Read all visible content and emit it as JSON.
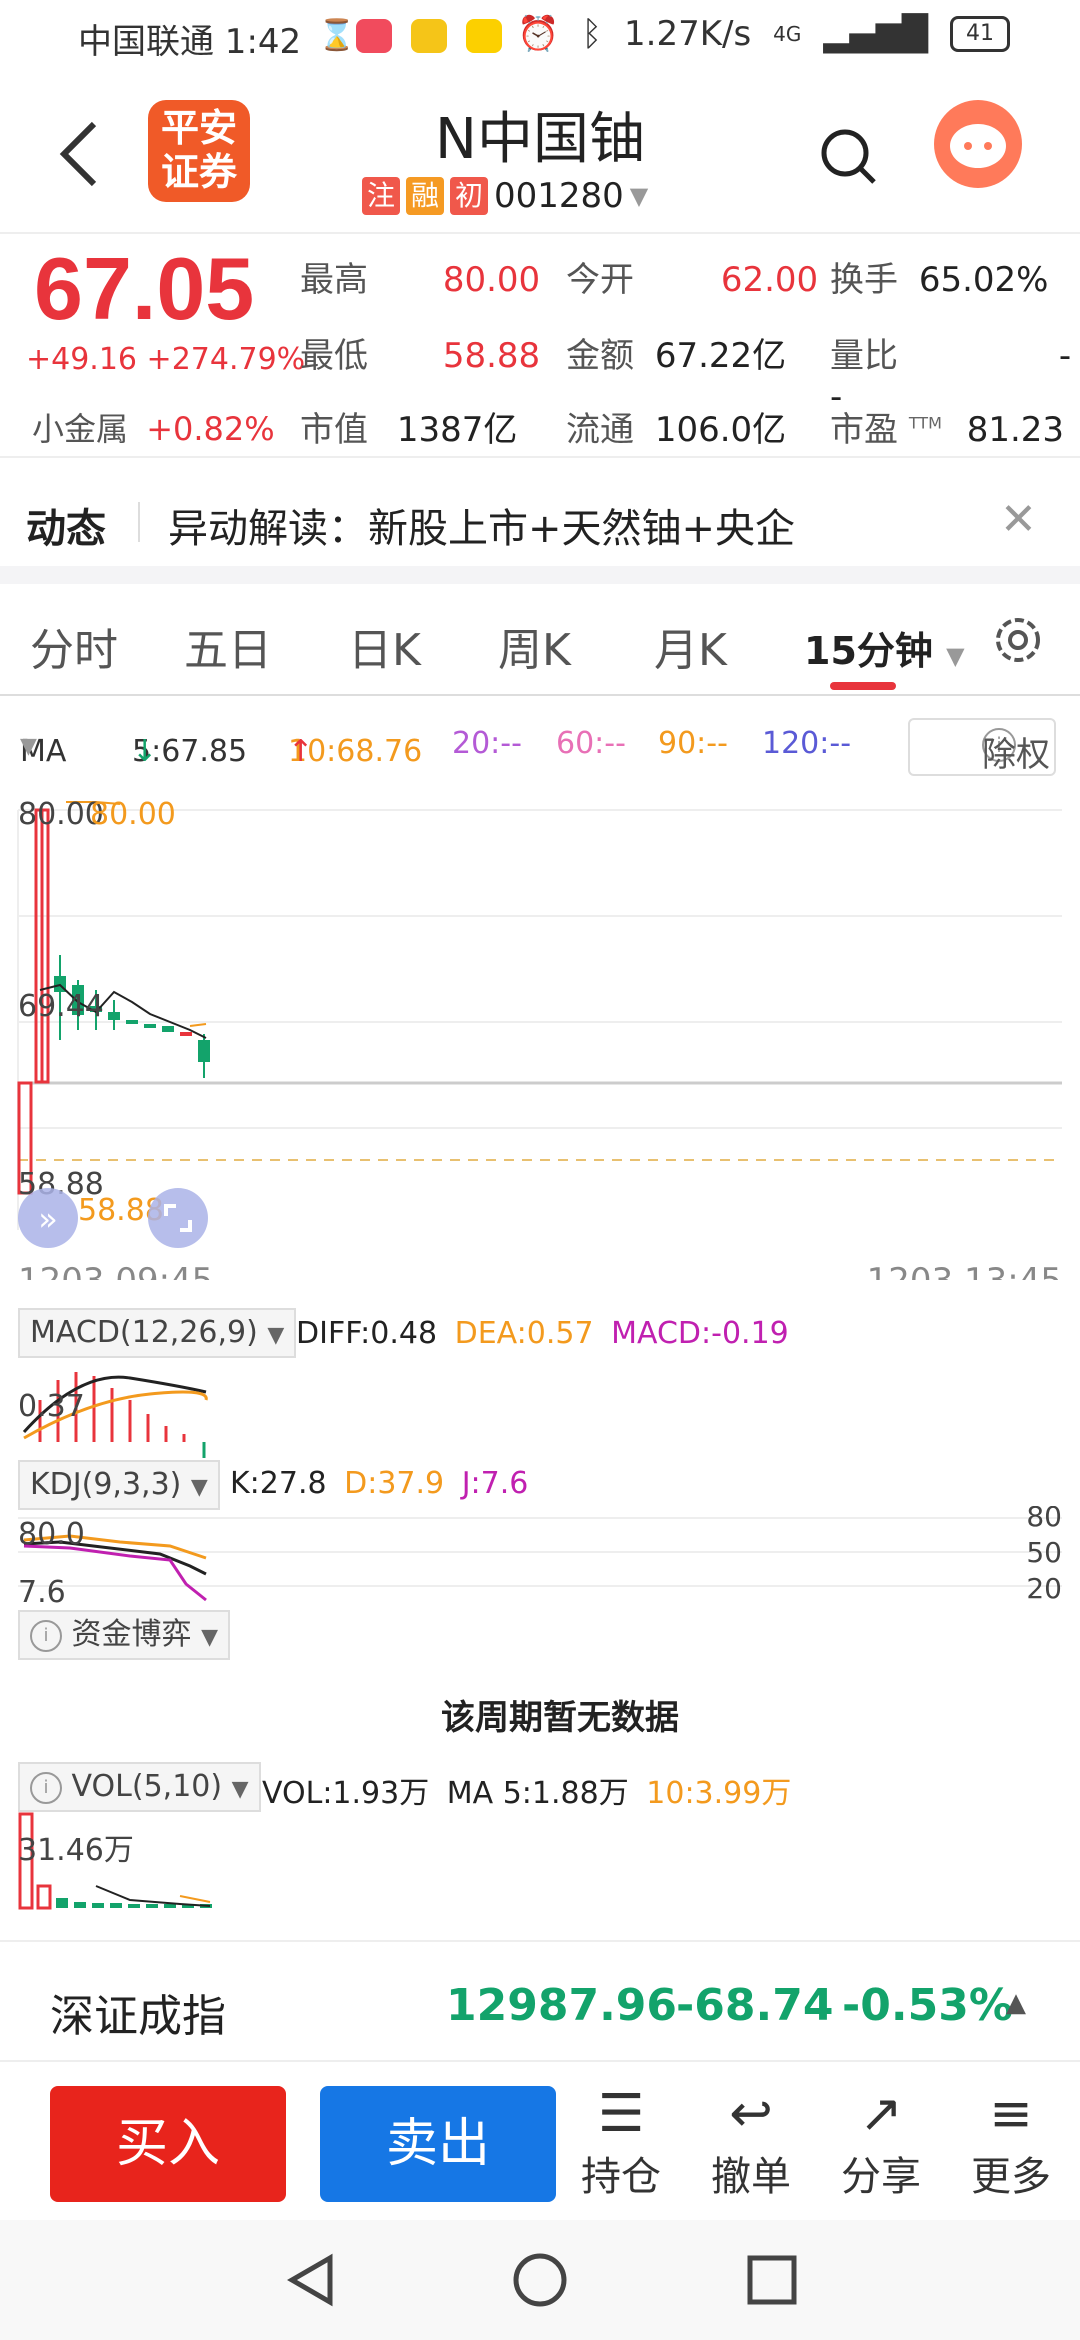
{
  "status_bar": {
    "carrier_time": "中国联通 1:42",
    "speed": "1.27K/s",
    "network": "4G",
    "battery": "41"
  },
  "header": {
    "logo_text_top": "平安",
    "logo_text_bottom": "证券",
    "title": "N中国铀",
    "tags": [
      "注",
      "融",
      "初"
    ],
    "code": "001280"
  },
  "quote": {
    "price": "67.05",
    "change": "+49.16 +274.79%",
    "sector_name": "小金属",
    "sector_change": "+0.82%",
    "grid": [
      {
        "label": "最高",
        "value": "80.00"
      },
      {
        "label": "今开",
        "value": "62.00"
      },
      {
        "label": "换手",
        "value": "65.02%"
      },
      {
        "label": "最低",
        "value": "58.88"
      },
      {
        "label": "金额",
        "value": "67.22亿"
      },
      {
        "label": "量比",
        "value": "--"
      },
      {
        "label": "市值",
        "value": "1387亿"
      },
      {
        "label": "流通",
        "value": "106.0亿"
      },
      {
        "label": "市盈",
        "value": "81.23"
      }
    ],
    "pe_sup": "TTM"
  },
  "news": {
    "head": "动态",
    "text": "异动解读：新股上市+天然铀+央企",
    "close": "✕"
  },
  "tabs": {
    "items": [
      "分时",
      "五日",
      "日K",
      "周K",
      "月K"
    ],
    "active": "15分钟"
  },
  "ma_legend": {
    "label": "MA",
    "ma5": "5:67.85",
    "ma10": "10:68.76",
    "ma20": "20:--",
    "ma60": "60:--",
    "ma90": "90:--",
    "ma120": "120:--",
    "fq_button": "除权"
  },
  "kline": {
    "top_label": "80.00",
    "top_label2": "80.00",
    "mid_label": "69.44",
    "bottom_label": "58.88",
    "bottom_label2": "58.88",
    "start_time": "1203 09:45",
    "end_time": "1203 13:45"
  },
  "macd": {
    "button": "MACD(12,26,9)",
    "diff": "DIFF:0.48",
    "dea": "DEA:0.57",
    "macd": "MACD:-0.19",
    "axis_label": "0.37"
  },
  "kdj": {
    "button": "KDJ(9,3,3)",
    "k": "K:27.8",
    "d": "D:37.9",
    "j": "J:7.6",
    "top": "80.0",
    "bottom": "7.6",
    "levels": [
      "80",
      "50",
      "20"
    ]
  },
  "capital": {
    "button": "资金博弈",
    "empty": "该周期暂无数据"
  },
  "vol": {
    "button": "VOL(5,10)",
    "vol": "VOL:1.93万",
    "ma5": "MA 5:1.88万",
    "ma10": "10:3.99万",
    "axis_label": "31.46万"
  },
  "index_bar": {
    "name": "深证成指",
    "value": "12987.96",
    "change": "-68.74",
    "pct": "-0.53%"
  },
  "bottom": {
    "buy": "买入",
    "sell": "卖出",
    "actions": [
      "持仓",
      "撤单",
      "分享",
      "更多"
    ]
  },
  "colors": {
    "up": "#e8343c",
    "down": "#13a36b",
    "sell_blue": "#1677e5"
  }
}
